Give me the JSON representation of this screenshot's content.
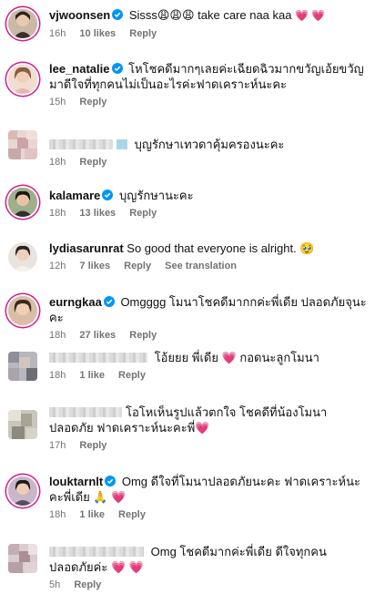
{
  "comments": [
    {
      "username": "vjwoonsen",
      "verified": true,
      "text": "Sisss😩😩😩 take care naa kaa",
      "hearts": "💗 💗",
      "time": "16h",
      "likes": "10 likes",
      "reply": "Reply"
    },
    {
      "username": "lee_natalie",
      "verified": true,
      "text": "โหโชคดีมากๆเลยค่ะเฉียดฉิวมากขวัญเอ้ยขวัญมาดีใจที่ทุกคนไม่เป็นอะไรค่ะฟาดเคราะห์นะคะ",
      "time": "15h",
      "reply": "Reply"
    },
    {
      "username": "",
      "verified": false,
      "text": "บุญรักษาเทวดาคุ้มครองนะคะ",
      "time": "18h",
      "reply": "Reply"
    },
    {
      "username": "kalamare",
      "verified": true,
      "text": "บุญรักษานะคะ",
      "time": "18h",
      "likes": "13 likes",
      "reply": "Reply"
    },
    {
      "username": "lydiasarunrat",
      "verified": false,
      "text": "So good that everyone is alright. 🥹",
      "time": "12h",
      "likes": "7 likes",
      "reply": "Reply",
      "translate": "See translation"
    },
    {
      "username": "eurngkaa",
      "verified": true,
      "text": "Omgggg โมนาโชคดีมากกค่ะพี่เดีย ปลอดภัยจุนะคะ",
      "time": "18h",
      "likes": "27 likes",
      "reply": "Reply"
    },
    {
      "username": "",
      "verified": false,
      "text": "โอ้ยยย พี่เดีย 💗 กอดนะลูกโมนา",
      "time": "18h",
      "likes": "1 like",
      "reply": "Reply"
    },
    {
      "username": "",
      "verified": false,
      "text": "โอโหเห็นรูปแล้วตกใจ โชคดีที่น้องโมนาปลอดภัย ฟาดเคราะห์นะคะพี่💗",
      "time": "17h",
      "reply": "Reply"
    },
    {
      "username": "louktarnlt",
      "verified": true,
      "text": "Omg ดีใจที่โมนาปลอดภัยนะคะ ฟาดเคราะห์นะคะพี่เดีย 🙏 💗",
      "time": "18h",
      "likes": "1 like",
      "reply": "Reply"
    },
    {
      "username": "",
      "verified": false,
      "text": "Omg โชคดีมากค่ะพี่เดีย ดีใจทุกคนปลอดภัยค่ะ 💗 💗",
      "time": "5h",
      "reply": "Reply"
    }
  ],
  "colors": {
    "verified": "#0095f6",
    "heart": "#e9255a",
    "meta": "#737373",
    "ring": "#d81b8a"
  }
}
